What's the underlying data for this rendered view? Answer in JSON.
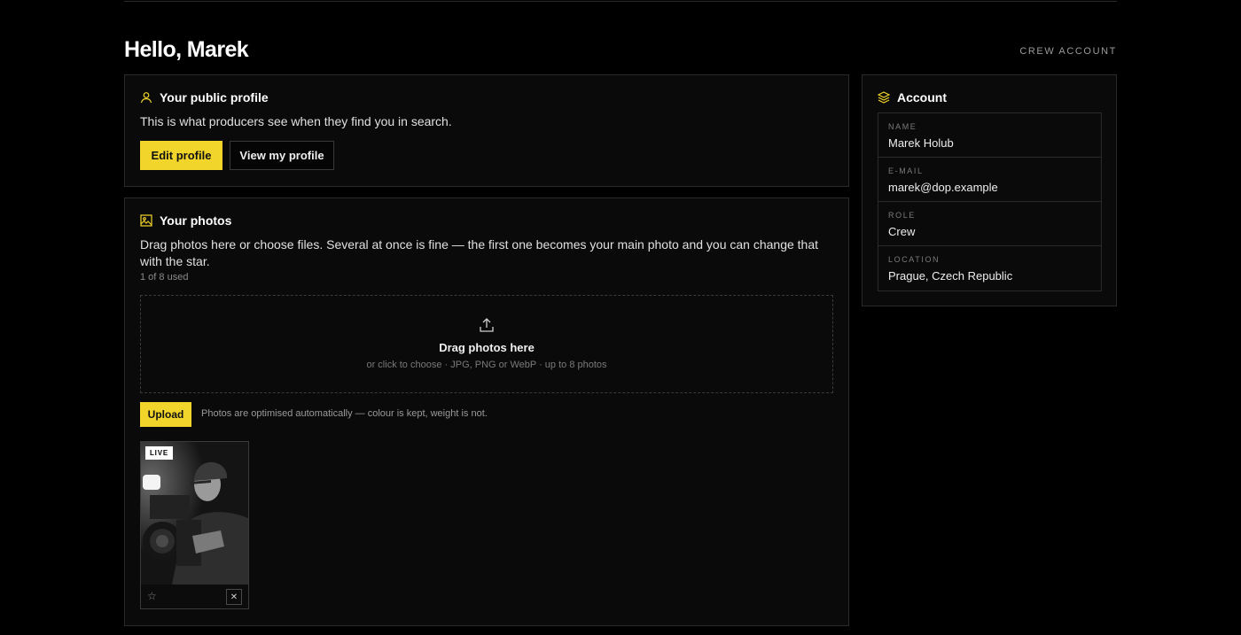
{
  "header": {
    "greeting": "Hello, Marek",
    "account_type": "CREW ACCOUNT"
  },
  "profile_card": {
    "title": "Your public profile",
    "icon": "user-icon",
    "description": "This is what producers see when they find you in search.",
    "edit_label": "Edit profile",
    "view_label": "View my profile"
  },
  "photos_card": {
    "title": "Your photos",
    "icon": "image-icon",
    "description": "Drag photos here or choose files. Several at once is fine — the first one becomes your main photo and you can change that with the star.",
    "usage": "1 of 8 used",
    "dropzone": {
      "icon": "upload-icon",
      "title": "Drag photos here",
      "subtitle": "or click to choose · JPG, PNG or WebP · up to 8 photos"
    },
    "upload_label": "Upload",
    "upload_note": "Photos are optimised automatically — colour is kept, weight is not.",
    "photos": [
      {
        "badge": "LIVE",
        "star": "☆",
        "remove": "✕"
      }
    ]
  },
  "account_card": {
    "title": "Account",
    "icon": "layers-icon",
    "fields": [
      {
        "label": "NAME",
        "value": "Marek Holub"
      },
      {
        "label": "E-MAIL",
        "value": "marek@dop.example"
      },
      {
        "label": "ROLE",
        "value": "Crew"
      },
      {
        "label": "LOCATION",
        "value": "Prague, Czech Republic"
      }
    ]
  },
  "colors": {
    "accent": "#f2d52a",
    "background": "#000000",
    "card": "#0a0a0a",
    "border": "#2a2a2a"
  }
}
